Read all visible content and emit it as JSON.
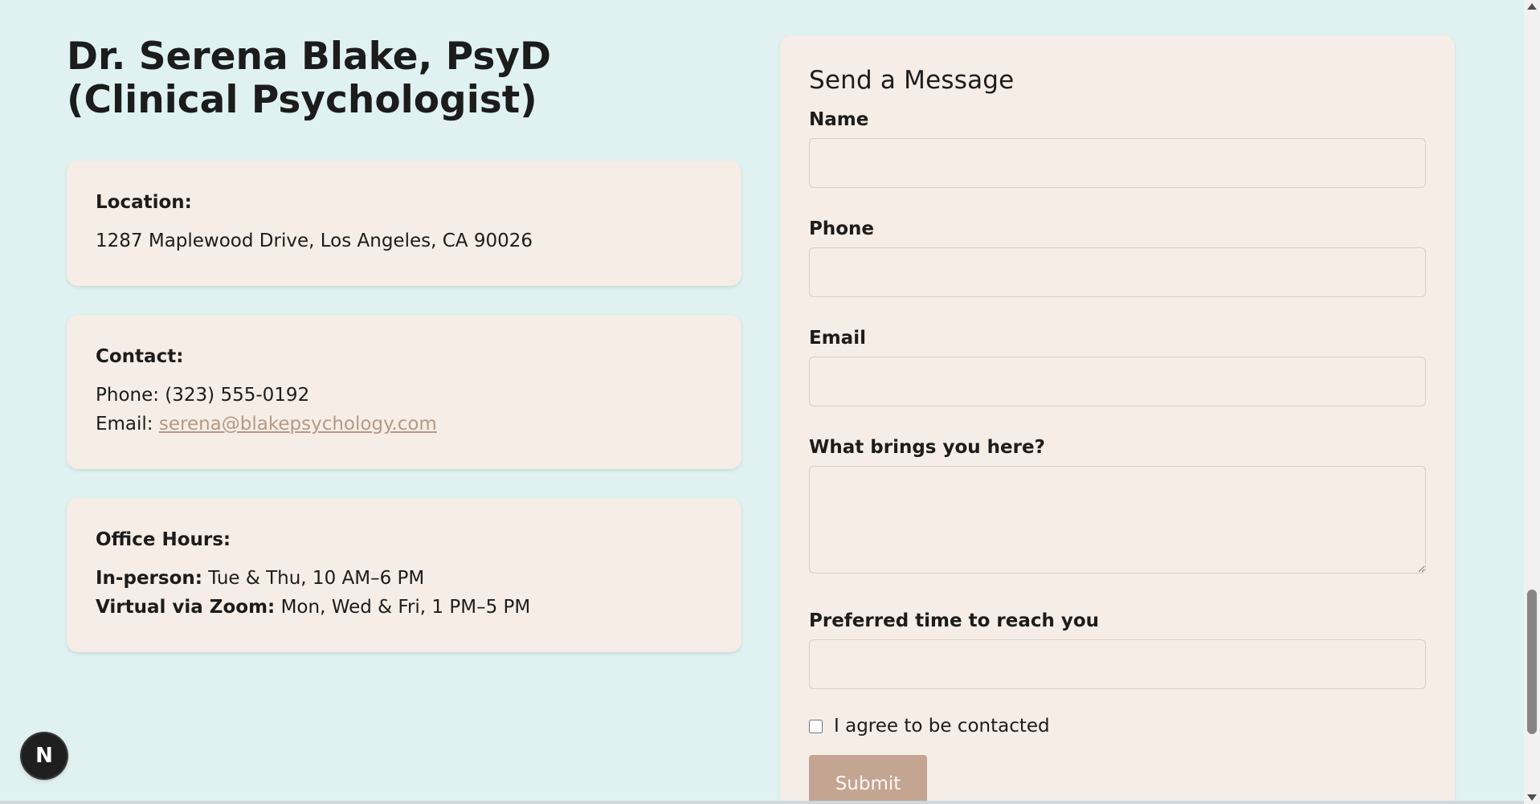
{
  "doctor": {
    "name_title": "Dr. Serena Blake, PsyD (Clinical Psychologist)"
  },
  "location": {
    "heading": "Location:",
    "address": "1287 Maplewood Drive, Los Angeles, CA 90026"
  },
  "contact": {
    "heading": "Contact:",
    "phone": "Phone: (323) 555-0192",
    "email_prefix": "Email: ",
    "email": "serena@blakepsychology.com"
  },
  "hours": {
    "heading": "Office Hours:",
    "inperson_label": "In-person:",
    "inperson_value": " Tue & Thu, 10 AM–6 PM",
    "virtual_label": "Virtual via Zoom:",
    "virtual_value": " Mon, Wed & Fri, 1 PM–5 PM"
  },
  "form": {
    "title": "Send a Message",
    "name_label": "Name",
    "name_value": "",
    "phone_label": "Phone",
    "phone_value": "",
    "email_label": "Email",
    "email_value": "",
    "reason_label": "What brings you here?",
    "reason_value": "",
    "time_label": "Preferred time to reach you",
    "time_value": "",
    "agree_label": "I agree to be contacted",
    "submit_label": "Submit"
  },
  "badge": {
    "letter": "N"
  },
  "colors": {
    "page_bg": "#dff2f1",
    "card_bg": "#f5ede6",
    "accent": "#c4a591",
    "link": "#b59a85"
  },
  "icons": {
    "badge": "nextjs-icon",
    "scroll_up": "scroll-up-arrow-icon",
    "scroll_down": "scroll-down-arrow-icon"
  }
}
